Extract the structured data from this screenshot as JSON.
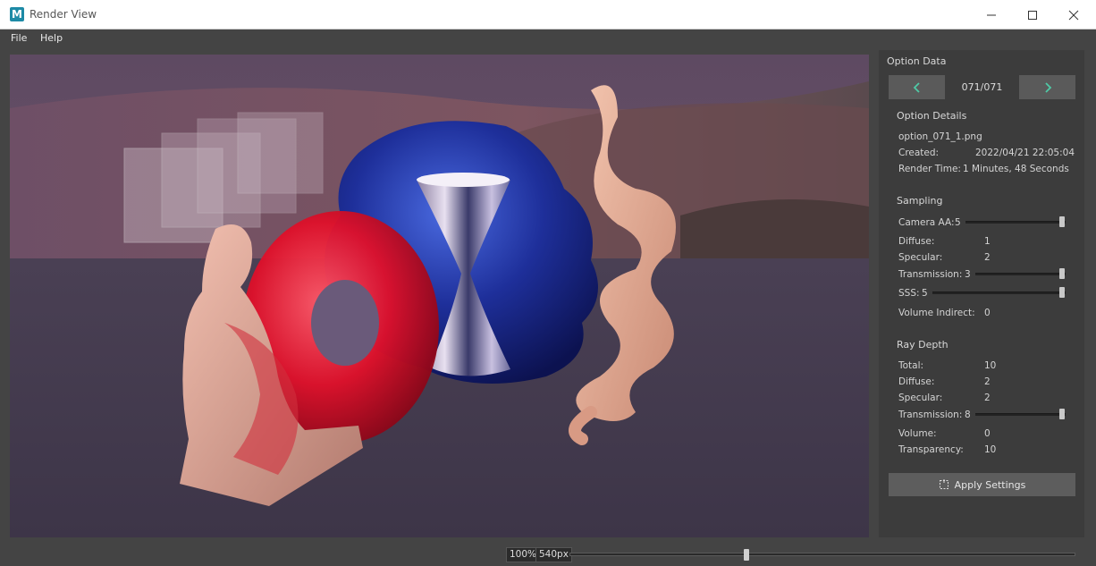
{
  "window": {
    "title": "Render View",
    "logo_letter": "M"
  },
  "menu": {
    "file": "File",
    "help": "Help"
  },
  "panel": {
    "option_data_heading": "Option Data",
    "counter": "071/071",
    "option_details_heading": "Option Details",
    "filename": "option_071_1.png",
    "created_label": "Created:",
    "created_value": "2022/04/21 22:05:04",
    "render_time_label": "Render Time:",
    "render_time_value": "1 Minutes, 48 Seconds",
    "sampling_heading": "Sampling",
    "sampling": {
      "camera_aa_label": "Camera AA:",
      "camera_aa_value": "5",
      "diffuse_label": "Diffuse:",
      "diffuse_value": "1",
      "specular_label": "Specular:",
      "specular_value": "2",
      "transmission_label": "Transmission:",
      "transmission_value": "3",
      "sss_label": "SSS:",
      "sss_value": "5",
      "volume_indirect_label": "Volume Indirect:",
      "volume_indirect_value": "0"
    },
    "ray_depth_heading": "Ray Depth",
    "ray_depth": {
      "total_label": "Total:",
      "total_value": "10",
      "diffuse_label": "Diffuse:",
      "diffuse_value": "2",
      "specular_label": "Specular:",
      "specular_value": "2",
      "transmission_label": "Transmission:",
      "transmission_value": "8",
      "volume_label": "Volume:",
      "volume_value": "0",
      "transparency_label": "Transparency:",
      "transparency_value": "10"
    },
    "apply_label": "Apply Settings"
  },
  "status": {
    "zoom_percent": "100%",
    "zoom_px": "540px"
  },
  "icons": {
    "prev": "chevron-left-icon",
    "next": "chevron-right-icon",
    "apply": "apply-settings-icon",
    "accent_color": "#4fc9a6"
  }
}
